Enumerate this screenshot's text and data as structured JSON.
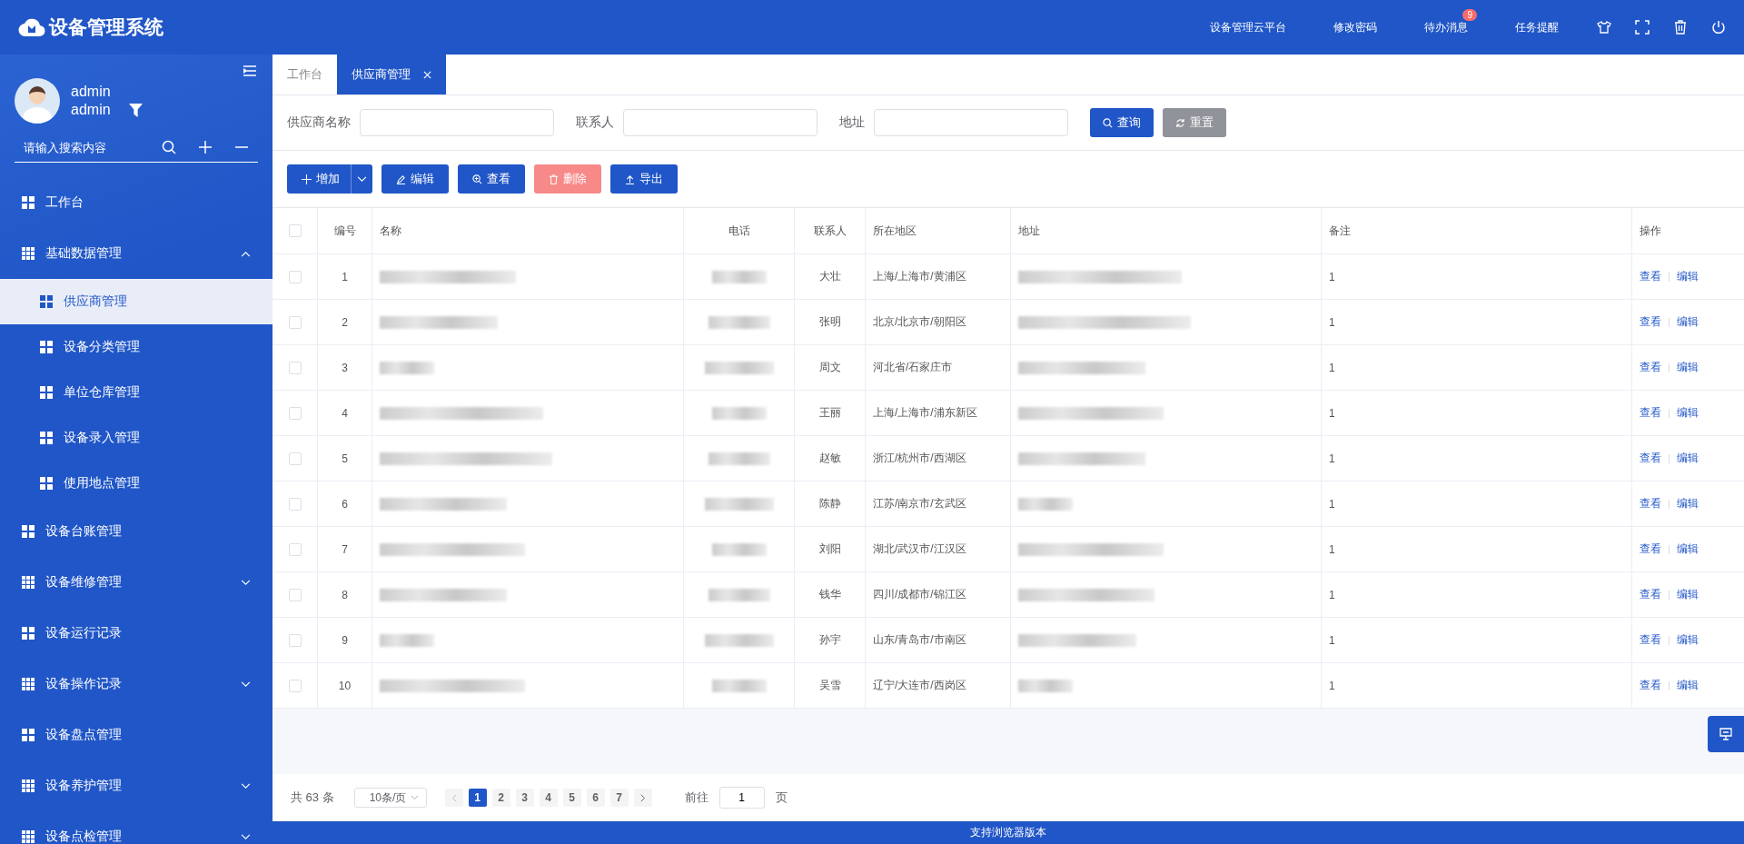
{
  "header": {
    "title": "设备管理系统",
    "links": [
      {
        "label": "设备管理云平台"
      },
      {
        "label": "修改密码"
      },
      {
        "label": "待办消息",
        "badge": "9"
      },
      {
        "label": "任务提醒"
      }
    ]
  },
  "user": {
    "name": "admin",
    "role": "admin"
  },
  "sidebar": {
    "search_placeholder": "请输入搜索内容",
    "items": [
      {
        "label": "工作台",
        "kind": "link",
        "selected": false
      },
      {
        "label": "基础数据管理",
        "kind": "group",
        "expanded": true,
        "selected": false,
        "children": [
          {
            "label": "供应商管理",
            "selected": true
          },
          {
            "label": "设备分类管理",
            "selected": false
          },
          {
            "label": "单位仓库管理",
            "selected": false
          },
          {
            "label": "设备录入管理",
            "selected": false
          },
          {
            "label": "使用地点管理",
            "selected": false
          }
        ]
      },
      {
        "label": "设备台账管理",
        "kind": "link",
        "selected": false
      },
      {
        "label": "设备维修管理",
        "kind": "group",
        "expanded": false,
        "selected": false
      },
      {
        "label": "设备运行记录",
        "kind": "link",
        "selected": false
      },
      {
        "label": "设备操作记录",
        "kind": "group",
        "expanded": false,
        "selected": false
      },
      {
        "label": "设备盘点管理",
        "kind": "link",
        "selected": false
      },
      {
        "label": "设备养护管理",
        "kind": "group",
        "expanded": false,
        "selected": false
      },
      {
        "label": "设备点检管理",
        "kind": "group",
        "expanded": false,
        "selected": false
      }
    ]
  },
  "tabs": [
    {
      "label": "工作台",
      "selected": false,
      "closable": false
    },
    {
      "label": "供应商管理",
      "selected": true,
      "closable": true
    }
  ],
  "filters": [
    {
      "label": "供应商名称"
    },
    {
      "label": "联系人"
    },
    {
      "label": "地址"
    }
  ],
  "filter_buttons": [
    {
      "label": "查询",
      "kind": "primary"
    },
    {
      "label": "重置",
      "kind": "secondary"
    }
  ],
  "actions": [
    {
      "label": "增加",
      "kind": "add"
    },
    {
      "label": "编辑",
      "kind": "edit"
    },
    {
      "label": "查看",
      "kind": "view"
    },
    {
      "label": "删除",
      "kind": "delete"
    },
    {
      "label": "导出",
      "kind": "export"
    }
  ],
  "table": {
    "all_checked": false,
    "columns": [
      "编号",
      "名称",
      "电话",
      "联系人",
      "所在地区",
      "地址",
      "备注",
      "操作"
    ],
    "rows": [
      {
        "no": "1",
        "contact": "大壮",
        "region": "上海/上海市/黄浦区",
        "remark": "1",
        "checked": false,
        "actions": [
          "查看",
          "编辑"
        ]
      },
      {
        "no": "2",
        "contact": "张明",
        "region": "北京/北京市/朝阳区",
        "remark": "1",
        "checked": false,
        "actions": [
          "查看",
          "编辑"
        ]
      },
      {
        "no": "3",
        "contact": "周文",
        "region": "河北省/石家庄市",
        "remark": "1",
        "checked": false,
        "actions": [
          "查看",
          "编辑"
        ]
      },
      {
        "no": "4",
        "contact": "王丽",
        "region": "上海/上海市/浦东新区",
        "remark": "1",
        "checked": false,
        "actions": [
          "查看",
          "编辑"
        ]
      },
      {
        "no": "5",
        "contact": "赵敏",
        "region": "浙江/杭州市/西湖区",
        "remark": "1",
        "checked": false,
        "actions": [
          "查看",
          "编辑"
        ]
      },
      {
        "no": "6",
        "contact": "陈静",
        "region": "江苏/南京市/玄武区",
        "remark": "1",
        "checked": false,
        "actions": [
          "查看",
          "编辑"
        ]
      },
      {
        "no": "7",
        "contact": "刘阳",
        "region": "湖北/武汉市/江汉区",
        "remark": "1",
        "checked": false,
        "actions": [
          "查看",
          "编辑"
        ]
      },
      {
        "no": "8",
        "contact": "钱华",
        "region": "四川/成都市/锦江区",
        "remark": "1",
        "checked": false,
        "actions": [
          "查看",
          "编辑"
        ]
      },
      {
        "no": "9",
        "contact": "孙宇",
        "region": "山东/青岛市/市南区",
        "remark": "1",
        "checked": false,
        "actions": [
          "查看",
          "编辑"
        ]
      },
      {
        "no": "10",
        "contact": "吴雪",
        "region": "辽宁/大连市/西岗区",
        "remark": "1",
        "checked": false,
        "actions": [
          "查看",
          "编辑"
        ]
      }
    ]
  },
  "pagination": {
    "total": "共 63 条",
    "page_size": "10条/页",
    "pages": [
      {
        "label": "1",
        "selected": true
      },
      {
        "label": "2",
        "selected": false
      },
      {
        "label": "3",
        "selected": false
      },
      {
        "label": "4",
        "selected": false
      },
      {
        "label": "5",
        "selected": false
      },
      {
        "label": "6",
        "selected": false
      },
      {
        "label": "7",
        "selected": false
      }
    ],
    "goto_label": "前往",
    "goto_value": "1",
    "goto_unit": "页"
  },
  "footer": "支持浏览器版本"
}
